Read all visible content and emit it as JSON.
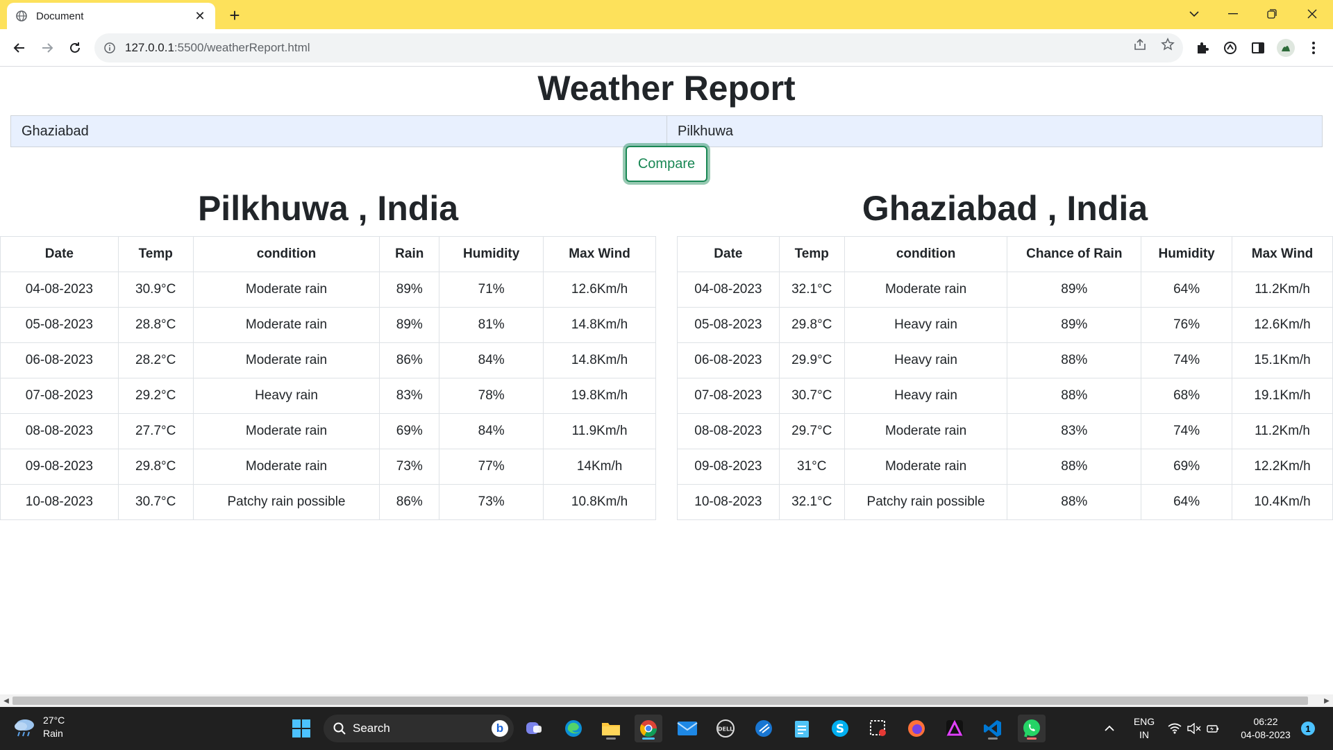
{
  "browser": {
    "tab_title": "Document",
    "url_host": "127.0.0.1",
    "url_rest": ":5500/weatherReport.html"
  },
  "page": {
    "title": "Weather Report",
    "input_left": "Ghaziabad",
    "input_right": "Pilkhuwa",
    "compare_label": "Compare"
  },
  "left_table": {
    "heading": "Pilkhuwa , India",
    "headers": [
      "Date",
      "Temp",
      "condition",
      "Rain",
      "Humidity",
      "Max Wind"
    ],
    "rows": [
      [
        "04-08-2023",
        "30.9°C",
        "Moderate rain",
        "89%",
        "71%",
        "12.6Km/h"
      ],
      [
        "05-08-2023",
        "28.8°C",
        "Moderate rain",
        "89%",
        "81%",
        "14.8Km/h"
      ],
      [
        "06-08-2023",
        "28.2°C",
        "Moderate rain",
        "86%",
        "84%",
        "14.8Km/h"
      ],
      [
        "07-08-2023",
        "29.2°C",
        "Heavy rain",
        "83%",
        "78%",
        "19.8Km/h"
      ],
      [
        "08-08-2023",
        "27.7°C",
        "Moderate rain",
        "69%",
        "84%",
        "11.9Km/h"
      ],
      [
        "09-08-2023",
        "29.8°C",
        "Moderate rain",
        "73%",
        "77%",
        "14Km/h"
      ],
      [
        "10-08-2023",
        "30.7°C",
        "Patchy rain possible",
        "86%",
        "73%",
        "10.8Km/h"
      ]
    ]
  },
  "right_table": {
    "heading": "Ghaziabad , India",
    "headers": [
      "Date",
      "Temp",
      "condition",
      "Chance of Rain",
      "Humidity",
      "Max Wind"
    ],
    "rows": [
      [
        "04-08-2023",
        "32.1°C",
        "Moderate rain",
        "89%",
        "64%",
        "11.2Km/h"
      ],
      [
        "05-08-2023",
        "29.8°C",
        "Heavy rain",
        "89%",
        "76%",
        "12.6Km/h"
      ],
      [
        "06-08-2023",
        "29.9°C",
        "Heavy rain",
        "88%",
        "74%",
        "15.1Km/h"
      ],
      [
        "07-08-2023",
        "30.7°C",
        "Heavy rain",
        "88%",
        "68%",
        "19.1Km/h"
      ],
      [
        "08-08-2023",
        "29.7°C",
        "Moderate rain",
        "83%",
        "74%",
        "11.2Km/h"
      ],
      [
        "09-08-2023",
        "31°C",
        "Moderate rain",
        "88%",
        "69%",
        "12.2Km/h"
      ],
      [
        "10-08-2023",
        "32.1°C",
        "Patchy rain possible",
        "88%",
        "64%",
        "10.4Km/h"
      ]
    ]
  },
  "taskbar": {
    "weather_temp": "27°C",
    "weather_cond": "Rain",
    "search_label": "Search",
    "lang_1": "ENG",
    "lang_2": "IN",
    "time": "06:22",
    "date": "04-08-2023",
    "notif_count": "1"
  },
  "colors": {
    "tabbar": "#fde15b",
    "accent_green": "#198754",
    "input_bg": "#e8f0fe",
    "taskbar": "#202020"
  }
}
